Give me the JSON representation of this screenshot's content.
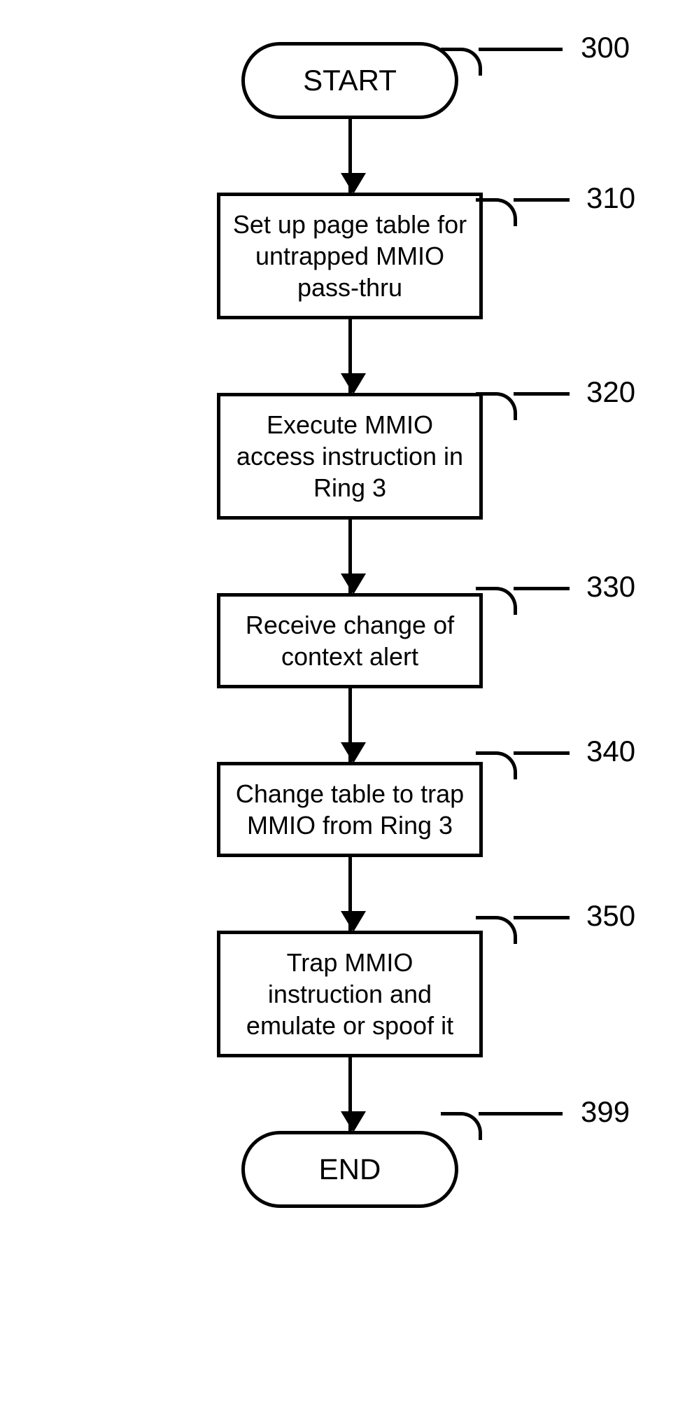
{
  "flow": {
    "start": "START",
    "end": "END",
    "steps": [
      "Set up page table for untrapped MMIO pass-thru",
      "Execute MMIO access instruction in Ring 3",
      "Receive change of context alert",
      "Change table to trap MMIO from Ring 3",
      "Trap MMIO instruction and emulate or spoof it"
    ]
  },
  "refs": {
    "start": "300",
    "step1": "310",
    "step2": "320",
    "step3": "330",
    "step4": "340",
    "step5": "350",
    "end": "399"
  }
}
